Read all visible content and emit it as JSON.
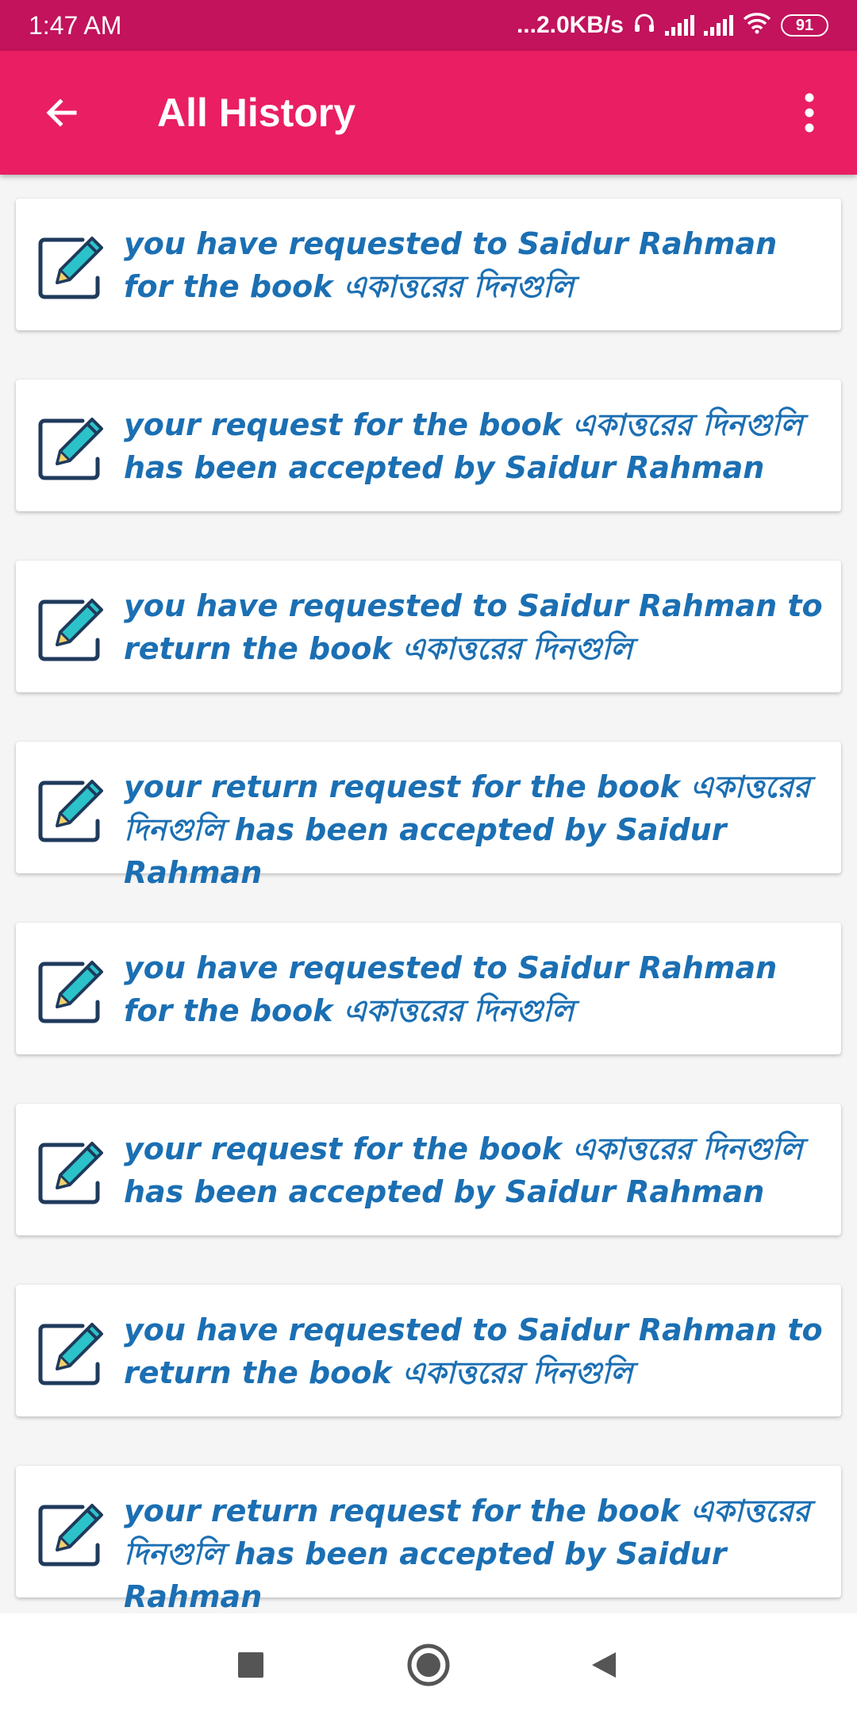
{
  "status_bar": {
    "time": "1:47 AM",
    "net_speed": "...2.0KB/s",
    "battery": "91"
  },
  "app_bar": {
    "title": "All History"
  },
  "history": {
    "items": [
      {
        "text": "you have requested to Saidur Rahman for the book একাত্তরের দিনগুলি"
      },
      {
        "text": "your request for the book একাত্তরের দিনগুলি has been accepted by Saidur Rahman"
      },
      {
        "text": "you have requested to Saidur Rahman to return the book একাত্তরের দিনগুলি"
      },
      {
        "text": "your return request for the book একাত্তরের দিনগুলি has been accepted by Saidur Rahman"
      },
      {
        "text": "you have requested to Saidur Rahman for the book একাত্তরের দিনগুলি"
      },
      {
        "text": "your request for the book একাত্তরের দিনগুলি has been accepted by Saidur Rahman"
      },
      {
        "text": "you have requested to Saidur Rahman to return the book একাত্তরের দিনগুলি"
      },
      {
        "text": "your return request for the book একাত্তরের দিনগুলি has been accepted by Saidur Rahman"
      }
    ]
  },
  "icons": {
    "back": "arrow-left-icon",
    "menu": "more-vert-icon",
    "item": "edit-note-icon",
    "headphones": "headphones-icon",
    "signal": "cell-signal-icon",
    "wifi": "wifi-icon",
    "battery": "battery-icon",
    "nav_recents": "square-icon",
    "nav_home": "circle-icon",
    "nav_back": "triangle-back-icon"
  },
  "colors": {
    "status_bar": "#c2135c",
    "app_bar": "#e91e63",
    "item_text": "#1b6fb3",
    "background": "#f5f5f5"
  }
}
